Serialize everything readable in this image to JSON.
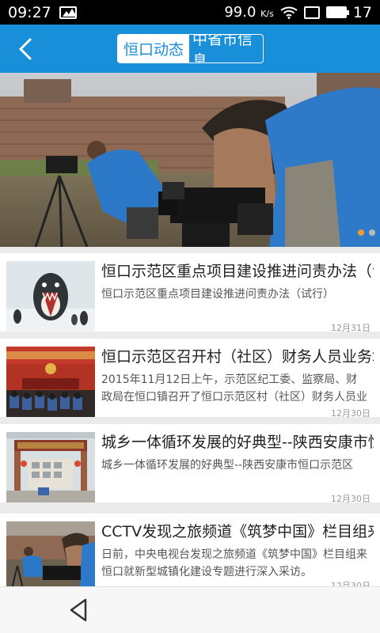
{
  "status_bar": {
    "time": "09:27",
    "speed": "99.0",
    "speed_unit": "K/s",
    "battery": "17"
  },
  "app_bar": {
    "back_icon": "chevron-left-icon",
    "tabs": [
      {
        "label": "恒口动态",
        "active": true
      },
      {
        "label": "中省市信息",
        "active": false
      }
    ]
  },
  "banner": {
    "slide_index": 1,
    "slide_count": 2
  },
  "news": [
    {
      "title": "恒口示范区重点项目建设推进问责办法（试..",
      "summary": "恒口示范区重点项目建设推进问责办法（试行）",
      "date": "12月31日"
    },
    {
      "title": "恒口示范区召开村（社区）财务人员业务培..",
      "summary": "2015年11月12日上午，示范区纪工委、监察局、财政局在恒口镇召开了恒口示范区村（社区）财务人员业",
      "date": "12月30日"
    },
    {
      "title": "城乡一体循环发展的好典型--陕西安康市恒..",
      "summary": "城乡一体循环发展的好典型--陕西安康市恒口示范区",
      "date": "12月30日"
    },
    {
      "title": "CCTV发现之旅频道《筑梦中国》栏目组来..",
      "summary": "日前，中央电视台发现之旅频道《筑梦中国》栏目组来恒口就新型城镇化建设专题进行深入采访。",
      "date": "12月30日"
    }
  ],
  "colors": {
    "accent": "#1a8fd9",
    "dot_active": "#f19a2a"
  }
}
